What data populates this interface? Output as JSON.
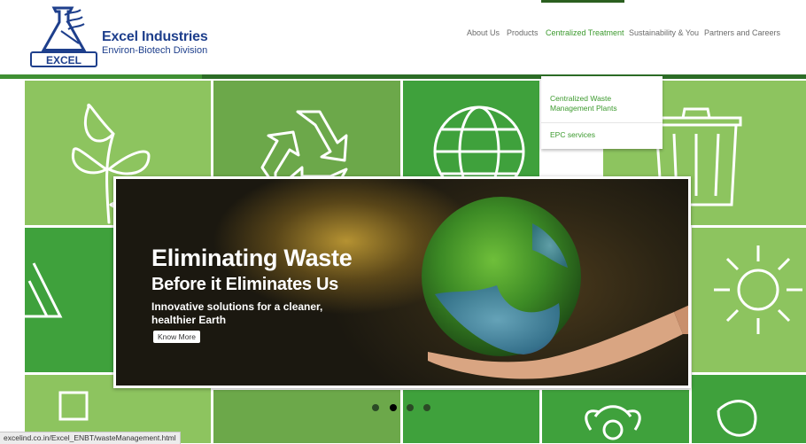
{
  "brand": {
    "logo_text": "EXCEL",
    "title": "Excel Industries",
    "subtitle": "Environ-Biotech Division",
    "color": "#1e3f8c"
  },
  "nav": {
    "items": [
      {
        "label": "About Us"
      },
      {
        "label": "Products"
      },
      {
        "label": "Centralized Treatment",
        "active": true
      },
      {
        "label": "Sustainability & You"
      },
      {
        "label": "Partners and Careers"
      }
    ],
    "active_color": "#3c9a2e"
  },
  "dropdown": {
    "items": [
      {
        "label": "Centralized Waste Management Plants"
      },
      {
        "label": "EPC services"
      }
    ]
  },
  "hero": {
    "headline": "Eliminating Waste",
    "subheadline": "Before it Eliminates Us",
    "tagline": "Innovative solutions for a cleaner, healthier Earth",
    "button_label": "Know More"
  },
  "carousel": {
    "total_slides": 4,
    "active_slide": 2
  },
  "status_bar": {
    "url": "excelind.co.in/Excel_ENBT/wasteManagement.html"
  },
  "icons": [
    "logo-icon",
    "leaves-icon",
    "recycle-icon",
    "globe-icon",
    "trash-can-icon",
    "triangle-recycle-icon",
    "sun-icon",
    "flower-icon"
  ],
  "colors": {
    "header_rule": "#2c6c26",
    "tile_light": "#8dc45f",
    "tile_mid": "#6ca84a",
    "tile_dark": "#3e9a3a"
  }
}
